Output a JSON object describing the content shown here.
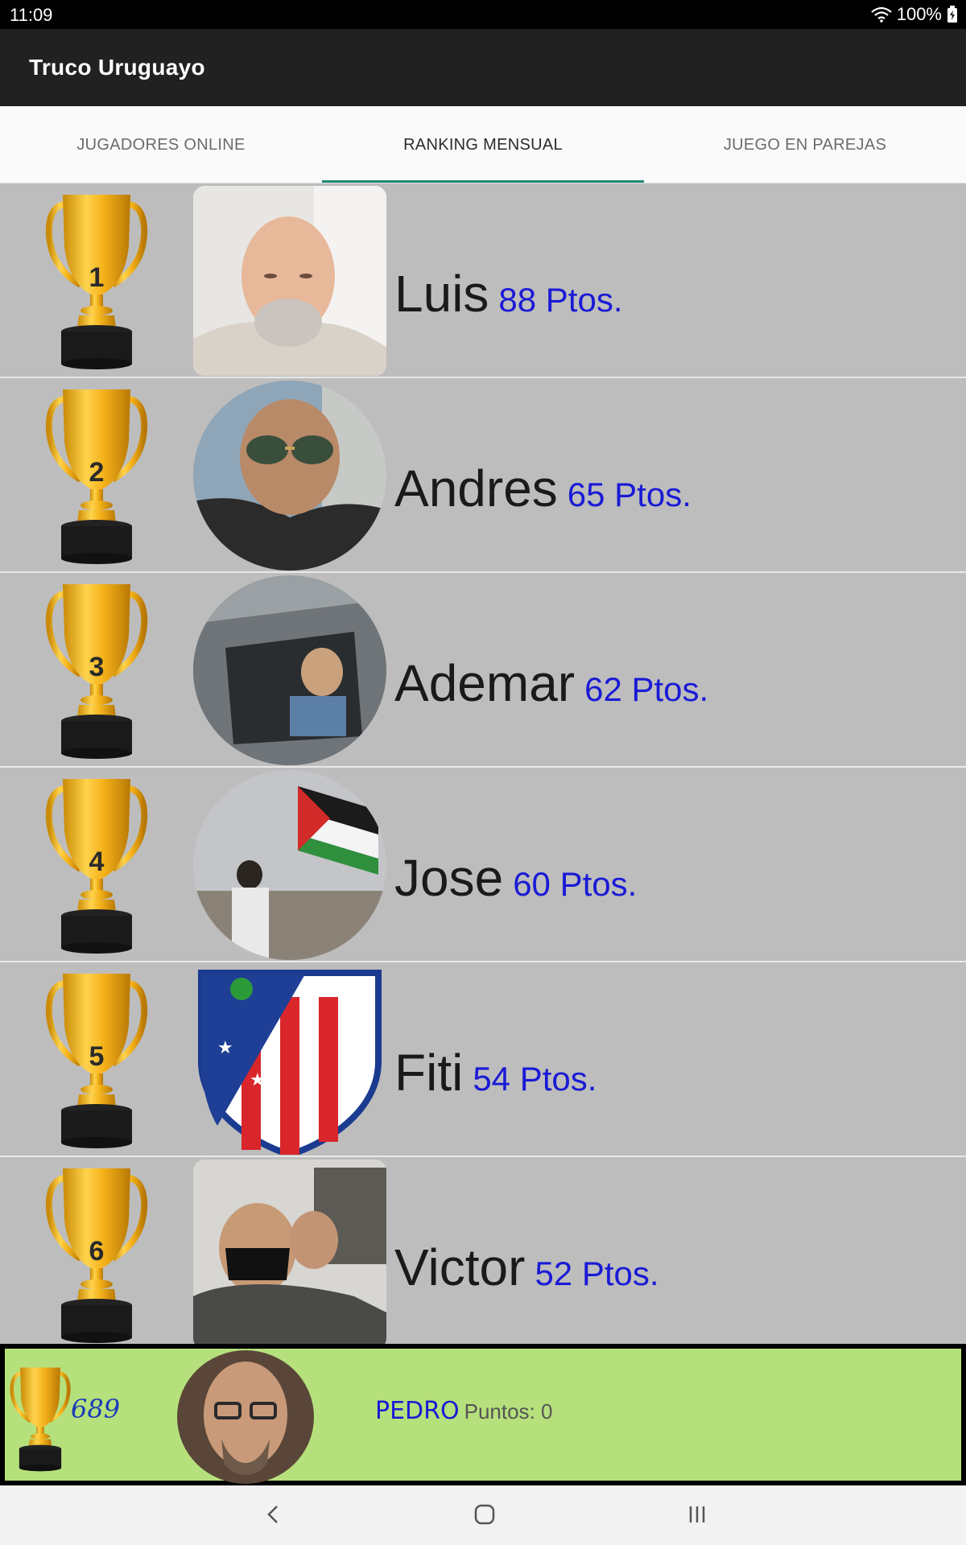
{
  "status_bar": {
    "time": "11:09",
    "battery": "100%"
  },
  "app_bar": {
    "title": "Truco Uruguayo"
  },
  "tabs": [
    {
      "label": "JUGADORES ONLINE",
      "active": false
    },
    {
      "label": "RANKING MENSUAL",
      "active": true
    },
    {
      "label": "JUEGO EN PAREJAS",
      "active": false
    }
  ],
  "ranking": [
    {
      "rank": "1",
      "name": "Luis",
      "points": "88 Ptos."
    },
    {
      "rank": "2",
      "name": "Andres",
      "points": "65 Ptos."
    },
    {
      "rank": "3",
      "name": "Ademar",
      "points": "62 Ptos."
    },
    {
      "rank": "4",
      "name": "Jose",
      "points": "60 Ptos."
    },
    {
      "rank": "5",
      "name": "Fiti",
      "points": "54 Ptos."
    },
    {
      "rank": "6",
      "name": "Victor",
      "points": "52 Ptos."
    }
  ],
  "current_user": {
    "rank": "689",
    "name": "PEDRO",
    "points": "Puntos: 0"
  },
  "colors": {
    "accent": "#1f8a76",
    "points_blue": "#1a1ad6",
    "footer_green": "#b6e07c",
    "trophy_gold": "#f2b21b"
  },
  "icons": [
    "wifi-icon",
    "battery-icon",
    "trophy-icon",
    "back-icon",
    "home-icon",
    "recents-icon"
  ]
}
